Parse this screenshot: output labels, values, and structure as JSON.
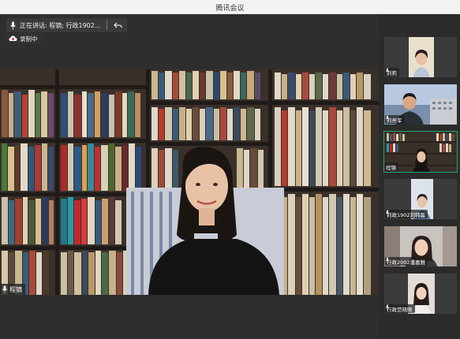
{
  "window": {
    "title": "腾讯会议"
  },
  "status": {
    "speaking_text": "正在讲话: 程镝; 行政1902...",
    "recording_label": "录制中"
  },
  "main_video": {
    "participant_name": "程镝"
  },
  "participants": [
    {
      "name": "刘莉"
    },
    {
      "name": "刘亮军"
    },
    {
      "name": "程镝"
    },
    {
      "name": "刘政1902刘韩磊"
    },
    {
      "name": "行政2002潘嘉魅"
    },
    {
      "name": "行政范晓晓"
    }
  ],
  "colors": {
    "active_border": "#1ea672",
    "recording_red": "#e0443c"
  }
}
